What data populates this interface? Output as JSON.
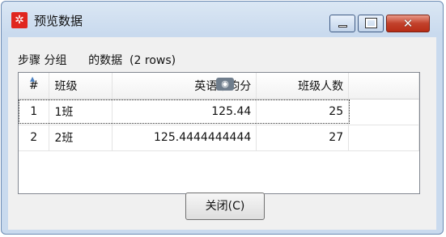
{
  "window": {
    "title": "预览数据",
    "app_icon_glyph": "✲",
    "close_glyph": "✕"
  },
  "caption": "步骤 分组      的数据  (2 rows)",
  "table": {
    "sort_glyph": "▲",
    "columns": [
      "#",
      "班级",
      "英语平均分",
      "班级人数",
      ""
    ],
    "rows": [
      [
        "1",
        "1班",
        "125.44",
        "25",
        ""
      ],
      [
        "2",
        "2班",
        "125.4444444444",
        "27",
        ""
      ]
    ]
  },
  "dialog": {
    "close_label": "关闭(C)"
  },
  "icons": {
    "eye": "eye-icon",
    "sort": "sort-ascending-icon"
  }
}
